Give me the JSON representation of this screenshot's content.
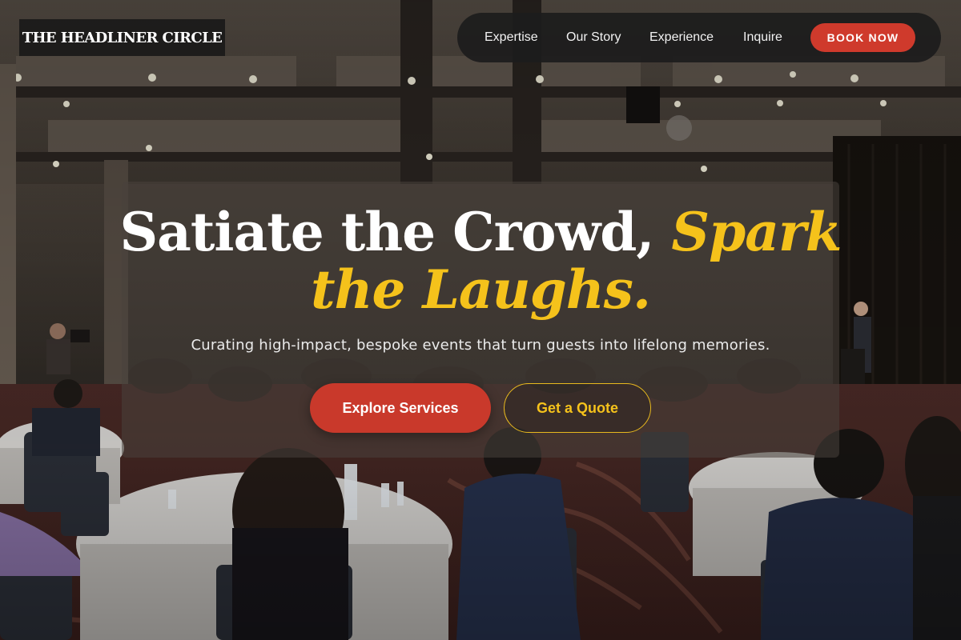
{
  "brand": {
    "name": "THE HEADLINER CIRCLE"
  },
  "nav": {
    "items": [
      {
        "label": "Expertise"
      },
      {
        "label": "Our Story"
      },
      {
        "label": "Experience"
      },
      {
        "label": "Inquire"
      }
    ],
    "cta_label": "BOOK NOW"
  },
  "hero": {
    "title_part1": "Satiate the Crowd,",
    "title_part2": "Spark",
    "title_part3": "the Laughs.",
    "subtitle": "Curating high-impact, bespoke events that turn guests into lifelong memories.",
    "primary_button": "Explore Services",
    "secondary_button": "Get a Quote"
  },
  "colors": {
    "accent_red": "#c9392b",
    "accent_gold": "#f5c21b",
    "nav_bg": "#1c1c1c",
    "text_light": "#ffffff"
  },
  "background": {
    "description_icon": "event-hall-photo"
  }
}
